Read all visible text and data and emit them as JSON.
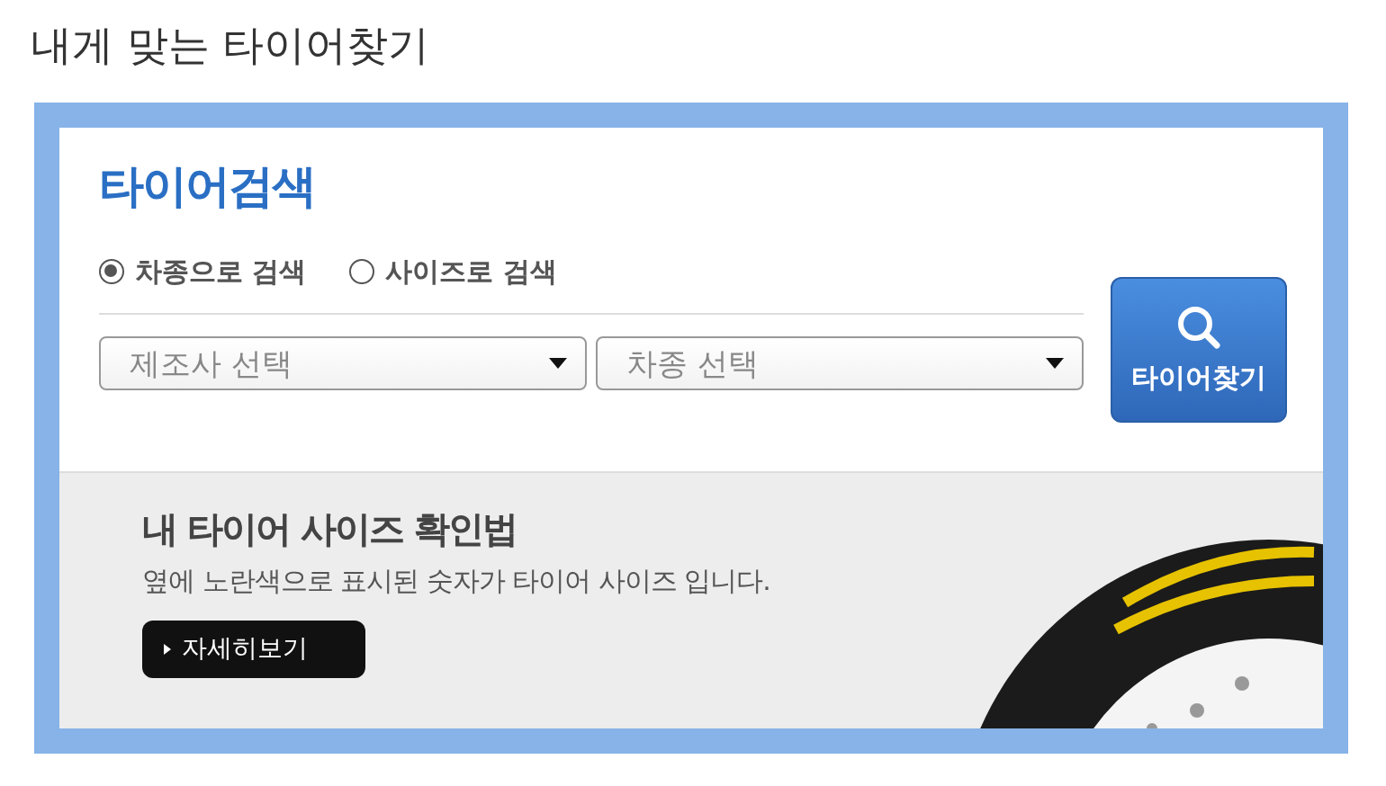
{
  "page_title": "내게 맞는 타이어찾기",
  "search": {
    "title": "타이어검색",
    "modes": [
      {
        "label": "차종으로 검색",
        "selected": true
      },
      {
        "label": "사이즈로 검색",
        "selected": false
      }
    ],
    "selects": [
      {
        "placeholder": "제조사 선택"
      },
      {
        "placeholder": "차종 선택"
      }
    ],
    "button": "타이어찾기"
  },
  "info": {
    "title": "내 타이어 사이즈 확인법",
    "description": "옆에 노란색으로 표시된 숫자가 타이어 사이즈 입니다.",
    "button": "자세히보기"
  }
}
